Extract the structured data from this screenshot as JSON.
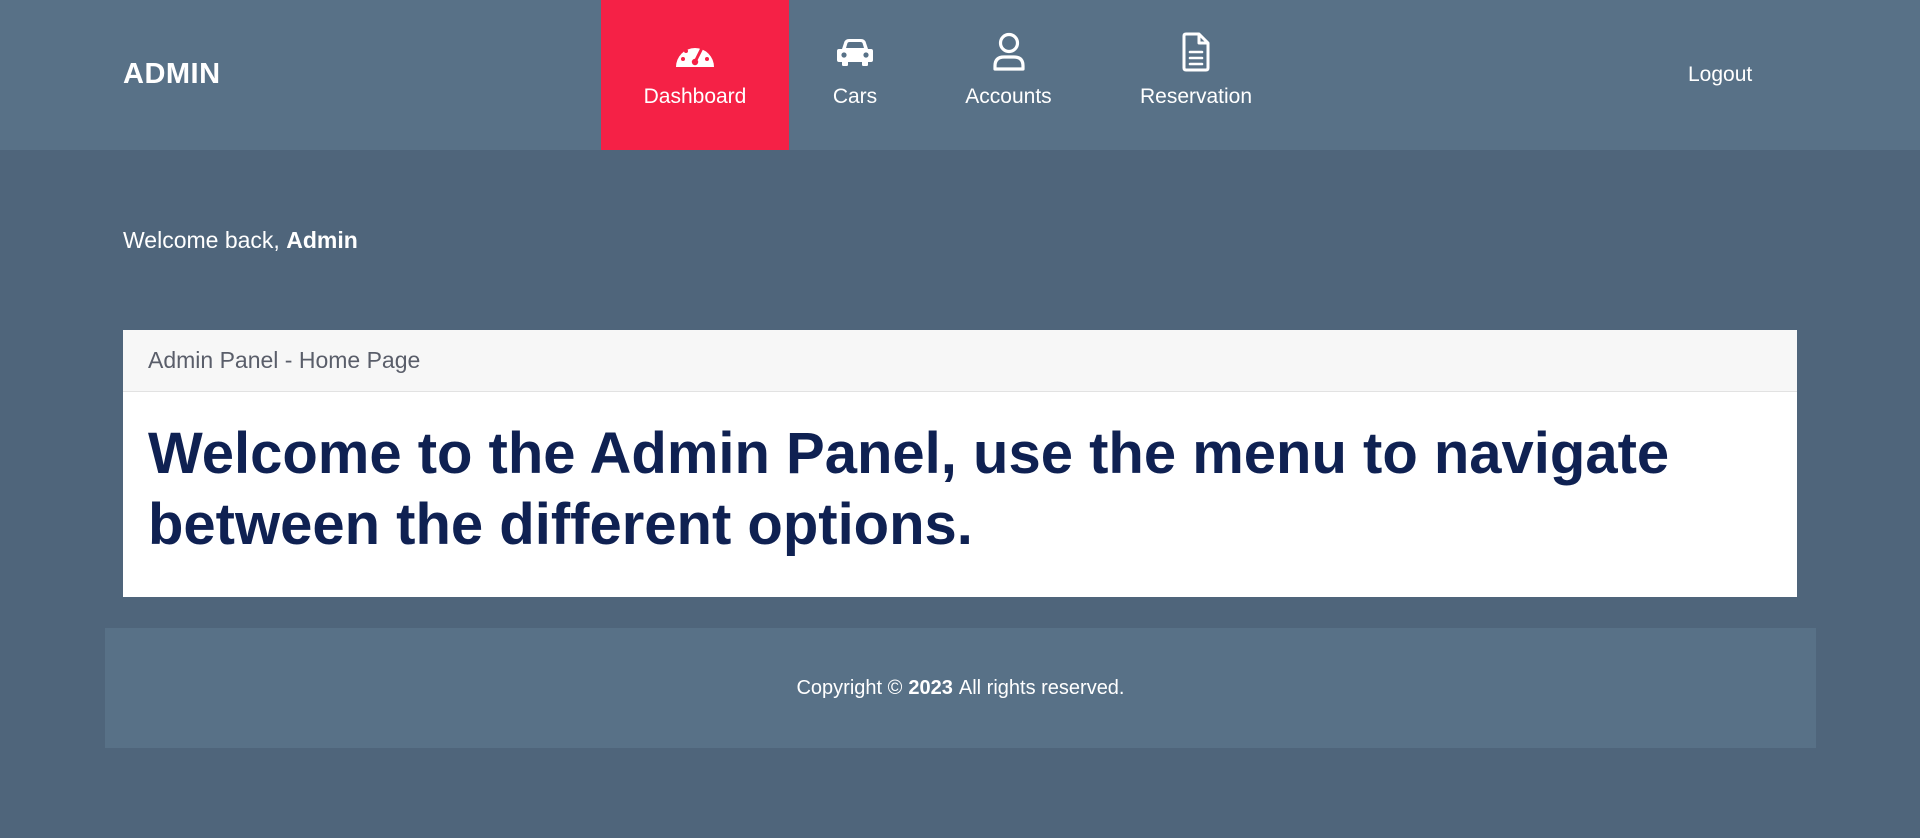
{
  "brand": "ADMIN",
  "nav": {
    "items": [
      {
        "label": "Dashboard",
        "icon": "speedometer-icon",
        "active": true
      },
      {
        "label": "Cars",
        "icon": "car-icon",
        "active": false
      },
      {
        "label": "Accounts",
        "icon": "user-icon",
        "active": false
      },
      {
        "label": "Reservation",
        "icon": "document-icon",
        "active": false
      }
    ],
    "active_color": "#f52146"
  },
  "logout_label": "Logout",
  "welcome": {
    "prefix": "Welcome back,",
    "name": "Admin"
  },
  "panel": {
    "header": "Admin Panel - Home Page",
    "message": "Welcome to the Admin Panel, use the menu to navigate between the different options."
  },
  "footer": {
    "prefix": "Copyright ©",
    "year": "2023",
    "suffix": "All rights reserved."
  },
  "colors": {
    "background": "#4f657b",
    "topbar": "#587187",
    "heading": "#0f2152"
  }
}
